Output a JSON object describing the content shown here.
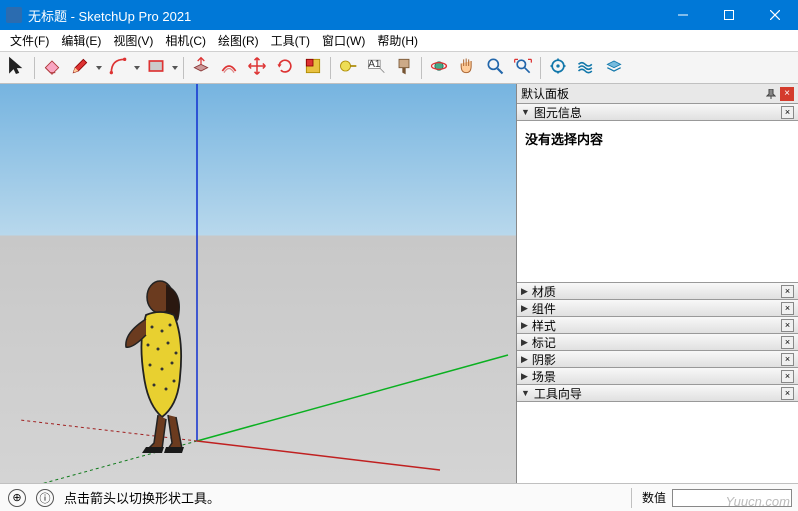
{
  "window": {
    "title": "无标题 - SketchUp Pro 2021"
  },
  "menu": {
    "items": [
      {
        "label": "文件(F)"
      },
      {
        "label": "编辑(E)"
      },
      {
        "label": "视图(V)"
      },
      {
        "label": "相机(C)"
      },
      {
        "label": "绘图(R)"
      },
      {
        "label": "工具(T)"
      },
      {
        "label": "窗口(W)"
      },
      {
        "label": "帮助(H)"
      }
    ]
  },
  "toolbar": {
    "tools": [
      {
        "name": "select",
        "icon": "cursor",
        "dd": false
      },
      {
        "name": "eraser",
        "icon": "eraser",
        "dd": false
      },
      {
        "name": "line",
        "icon": "pencil",
        "dd": true
      },
      {
        "name": "arc",
        "icon": "arc",
        "dd": true
      },
      {
        "name": "shape",
        "icon": "rect",
        "dd": true
      },
      {
        "name": "pushpull",
        "icon": "pushpull",
        "dd": false
      },
      {
        "name": "offset",
        "icon": "offset",
        "dd": false
      },
      {
        "name": "move",
        "icon": "move",
        "dd": false
      },
      {
        "name": "rotate",
        "icon": "rotate",
        "dd": false
      },
      {
        "name": "scale",
        "icon": "scale",
        "dd": false
      },
      {
        "name": "tape",
        "icon": "tape",
        "dd": false
      },
      {
        "name": "text",
        "icon": "text",
        "dd": false
      },
      {
        "name": "paint",
        "icon": "paint",
        "dd": false
      },
      {
        "name": "orbit",
        "icon": "orbit",
        "dd": false
      },
      {
        "name": "pan",
        "icon": "pan",
        "dd": false
      },
      {
        "name": "zoom",
        "icon": "zoom",
        "dd": false
      },
      {
        "name": "zoomext",
        "icon": "zoomext",
        "dd": false
      },
      {
        "name": "ext1",
        "icon": "gear1",
        "dd": false
      },
      {
        "name": "ext2",
        "icon": "waves",
        "dd": false
      },
      {
        "name": "ext3",
        "icon": "layers",
        "dd": false
      }
    ]
  },
  "tray": {
    "title": "默认面板",
    "sections": [
      {
        "label": "图元信息",
        "expanded": true,
        "body": "没有选择内容"
      },
      {
        "label": "材质",
        "expanded": false
      },
      {
        "label": "组件",
        "expanded": false
      },
      {
        "label": "样式",
        "expanded": false
      },
      {
        "label": "标记",
        "expanded": false
      },
      {
        "label": "阴影",
        "expanded": false
      },
      {
        "label": "场景",
        "expanded": false
      },
      {
        "label": "工具向导",
        "expanded": true
      }
    ]
  },
  "status": {
    "hint": "点击箭头以切换形状工具。",
    "vcb_label": "数值"
  },
  "watermark": "Yuucn.com"
}
